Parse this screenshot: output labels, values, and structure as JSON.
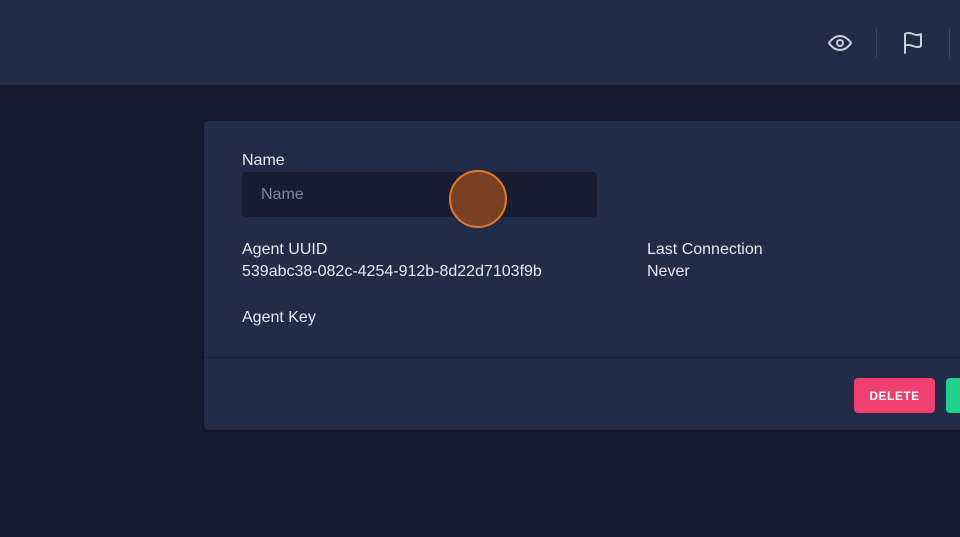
{
  "header": {
    "icons": [
      "eye-icon",
      "flag-icon"
    ]
  },
  "form": {
    "name_label": "Name",
    "name_placeholder": "Name",
    "name_value": "",
    "uuid_label": "Agent UUID",
    "uuid_value": "539abc38-082c-4254-912b-8d22d7103f9b",
    "last_connection_label": "Last Connection",
    "last_connection_value": "Never",
    "agent_key_label": "Agent Key"
  },
  "footer": {
    "delete_label": "DELETE",
    "save_label": ""
  },
  "colors": {
    "background": "#161a2e",
    "panel": "#222b47",
    "input_bg": "#171c30",
    "delete": "#ee3f6e",
    "save": "#1fd18b",
    "cursor": "#e07a2e"
  }
}
